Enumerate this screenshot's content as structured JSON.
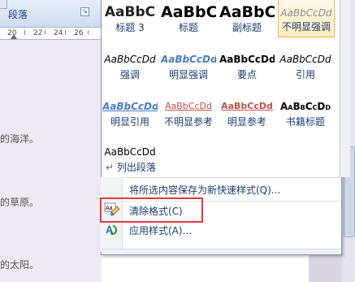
{
  "ribbon": {
    "group_label": "段落",
    "launcher_icon": "↘"
  },
  "ruler": {
    "marks": [
      "20",
      "22",
      "24",
      "26"
    ]
  },
  "document": {
    "lines": [
      "的海洋。",
      "的草原。",
      "的太阳。"
    ]
  },
  "gallery": {
    "styles": [
      {
        "sample": "AaBbC",
        "name": "标题 3",
        "selected": false
      },
      {
        "sample": "AaBbC",
        "name": "标题",
        "selected": false
      },
      {
        "sample": "AaBbC",
        "name": "副标题",
        "selected": false
      },
      {
        "sample": "AaBbCcDd",
        "name": "不明显强调",
        "selected": true
      },
      {
        "sample": "AaBbCcDd",
        "name": "强调",
        "selected": false
      },
      {
        "sample": "AaBbCcDd",
        "name": "明显强调",
        "selected": false
      },
      {
        "sample": "AaBbCcDd",
        "name": "要点",
        "selected": false
      },
      {
        "sample": "AaBbCcDd",
        "name": "引用",
        "selected": false
      },
      {
        "sample": "AaBbCcDd",
        "name": "明显引用",
        "selected": false
      },
      {
        "sample": "AaBbCcDd",
        "name": "不明显参考",
        "selected": false
      },
      {
        "sample": "AaBbCcDd",
        "name": "明显参考",
        "selected": false
      },
      {
        "sample": "AaBbCcDd",
        "name": "书籍标题",
        "selected": false
      },
      {
        "sample": "AaBbCcDd",
        "name": "列出段落",
        "selected": false
      }
    ],
    "list_para_mark": "↵"
  },
  "menu": {
    "save_selection": "将所选内容保存为新快速样式(Q)...",
    "clear_formatting": "清除格式(C)",
    "apply_styles": "应用样式(A)..."
  },
  "colors": {
    "highlight": "#e23a3a",
    "selected_border": "#e8b24c",
    "style_name": "#1f3a6e"
  }
}
